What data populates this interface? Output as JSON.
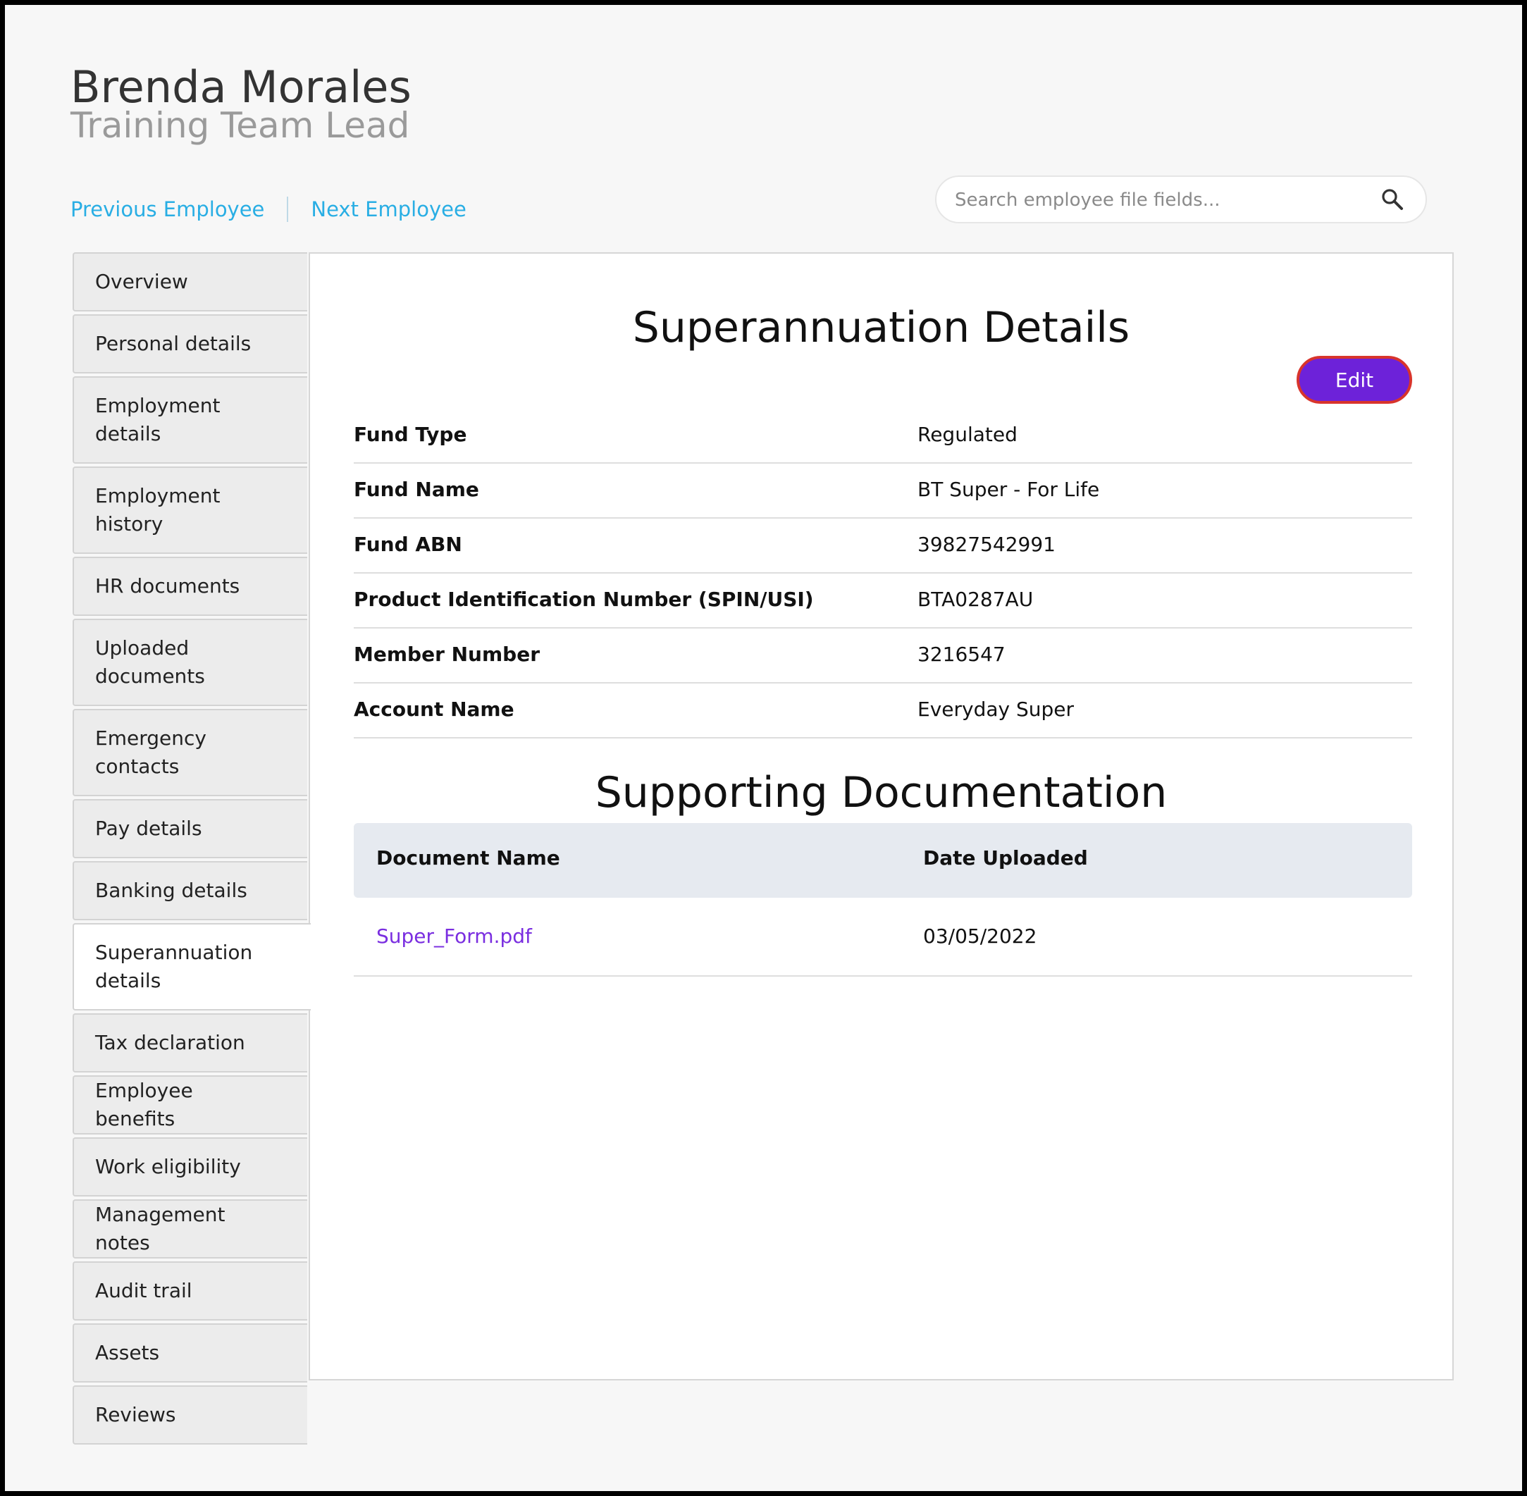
{
  "employee": {
    "name": "Brenda Morales",
    "title": "Training Team Lead"
  },
  "nav": {
    "previous": "Previous Employee",
    "next": "Next Employee"
  },
  "search": {
    "placeholder": "Search employee file fields..."
  },
  "sidebar": {
    "items": [
      {
        "label": "Overview"
      },
      {
        "label": "Personal details"
      },
      {
        "label": "Employment details"
      },
      {
        "label": "Employment history"
      },
      {
        "label": "HR documents"
      },
      {
        "label": "Uploaded documents"
      },
      {
        "label": "Emergency contacts"
      },
      {
        "label": "Pay details"
      },
      {
        "label": "Banking details"
      },
      {
        "label": "Superannuation details"
      },
      {
        "label": "Tax declaration"
      },
      {
        "label": "Employee benefits"
      },
      {
        "label": "Work eligibility"
      },
      {
        "label": "Management notes"
      },
      {
        "label": "Audit trail"
      },
      {
        "label": "Assets"
      },
      {
        "label": "Reviews"
      }
    ],
    "active": "Superannuation details"
  },
  "details": {
    "title": "Superannuation Details",
    "edit_label": "Edit",
    "rows": [
      {
        "label": "Fund Type",
        "value": "Regulated"
      },
      {
        "label": "Fund Name",
        "value": "BT Super - For Life"
      },
      {
        "label": "Fund ABN",
        "value": "39827542991"
      },
      {
        "label": "Product Identification Number (SPIN/USI)",
        "value": "BTA0287AU"
      },
      {
        "label": "Member Number",
        "value": "3216547"
      },
      {
        "label": "Account Name",
        "value": "Everyday Super"
      }
    ]
  },
  "docs": {
    "title": "Supporting Documentation",
    "headers": [
      "Document Name",
      "Date Uploaded"
    ],
    "rows": [
      {
        "name": "Super_Form.pdf",
        "date": "03/05/2022"
      }
    ]
  },
  "colors": {
    "accent": "#6d22d9",
    "link": "#29aee4",
    "doc_link": "#7a2ee0",
    "edit_border": "#d8342c"
  }
}
